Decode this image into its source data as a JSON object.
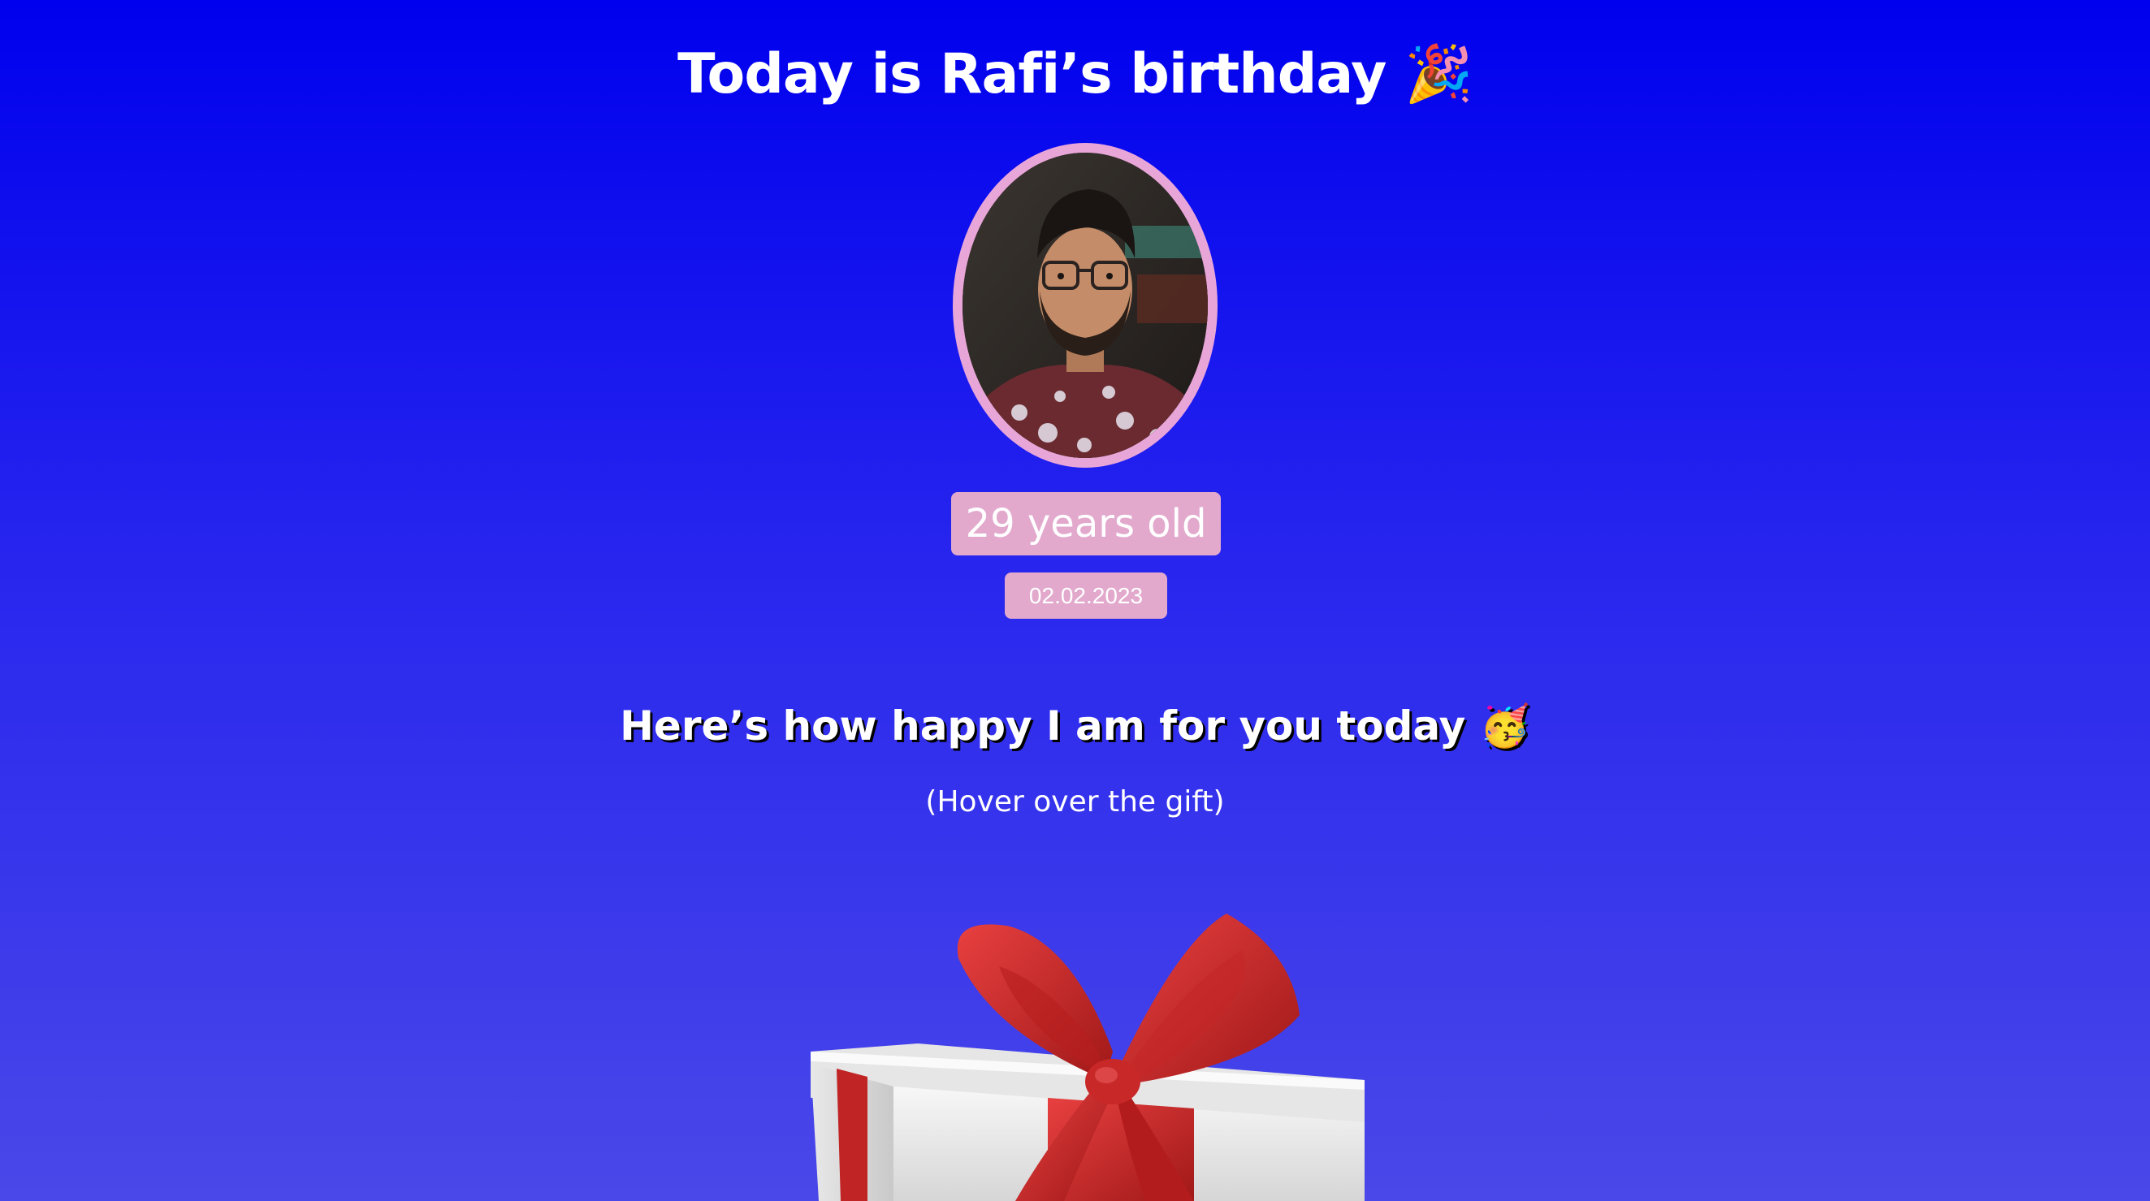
{
  "header": {
    "title": "Today is Rafi’s birthday",
    "title_emoji": "🎉"
  },
  "profile": {
    "photo_alt": "Rafi",
    "age": "29 years old",
    "date": "02.02.2023"
  },
  "message": {
    "text": "Here’s how happy I am for you today",
    "emoji": "🥳",
    "hint": "(Hover over the gift)"
  },
  "colors": {
    "background_top": "#0000ee",
    "background_bottom": "#4a48e8",
    "badge": "#e2a9cd",
    "avatar_border": "#e8a6d8",
    "ribbon": "#d42a2a",
    "box": "#f2f2f2"
  },
  "icons": {
    "party_popper": "party-popper-icon",
    "partying_face": "partying-face-icon",
    "gift": "gift-box-icon"
  }
}
